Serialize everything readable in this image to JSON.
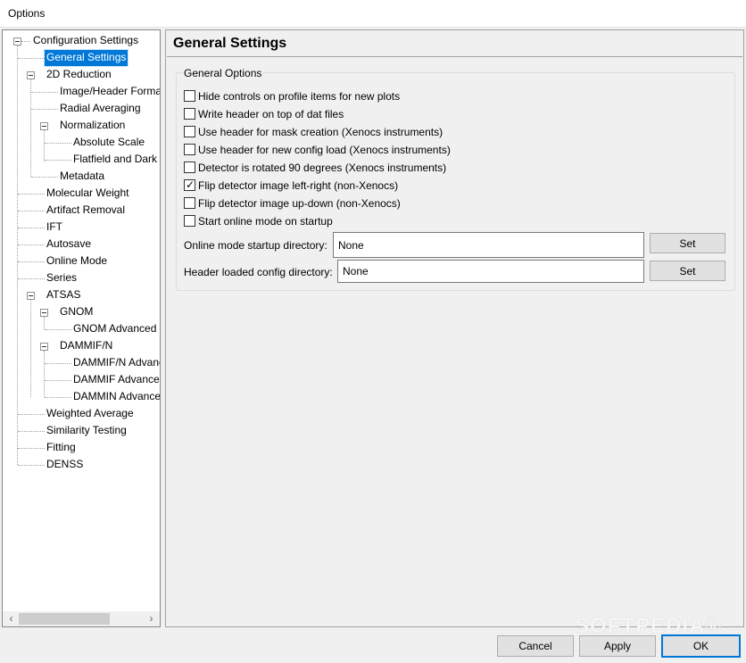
{
  "window": {
    "title": "Options"
  },
  "tree": {
    "items": [
      {
        "label": "Configuration Settings"
      },
      {
        "label": "General Settings"
      },
      {
        "label": "2D Reduction"
      },
      {
        "label": "Image/Header Format"
      },
      {
        "label": "Radial Averaging"
      },
      {
        "label": "Normalization"
      },
      {
        "label": "Absolute Scale"
      },
      {
        "label": "Flatfield and Dark"
      },
      {
        "label": "Metadata"
      },
      {
        "label": "Molecular Weight"
      },
      {
        "label": "Artifact Removal"
      },
      {
        "label": "IFT"
      },
      {
        "label": "Autosave"
      },
      {
        "label": "Online Mode"
      },
      {
        "label": "Series"
      },
      {
        "label": "ATSAS"
      },
      {
        "label": "GNOM"
      },
      {
        "label": "GNOM Advanced"
      },
      {
        "label": "DAMMIF/N"
      },
      {
        "label": "DAMMIF/N Advanced"
      },
      {
        "label": "DAMMIF Advanced"
      },
      {
        "label": "DAMMIN Advanced"
      },
      {
        "label": "Weighted Average"
      },
      {
        "label": "Similarity Testing"
      },
      {
        "label": "Fitting"
      },
      {
        "label": "DENSS"
      }
    ],
    "selected": "General Settings"
  },
  "scroll": {
    "left_arrow": "‹",
    "right_arrow": "›"
  },
  "main": {
    "title": "General Settings",
    "group_label": "General Options",
    "options": [
      {
        "label": "Hide controls on profile items for new plots",
        "checked": false
      },
      {
        "label": "Write header on top of dat files",
        "checked": false
      },
      {
        "label": "Use header for mask creation (Xenocs instruments)",
        "checked": false
      },
      {
        "label": "Use header for new config load (Xenocs instruments)",
        "checked": false
      },
      {
        "label": "Detector is rotated 90 degrees (Xenocs instruments)",
        "checked": false
      },
      {
        "label": "Flip detector image left-right (non-Xenocs)",
        "checked": true
      },
      {
        "label": "Flip detector image up-down (non-Xenocs)",
        "checked": false
      },
      {
        "label": "Start online mode on startup",
        "checked": false
      }
    ],
    "online_dir": {
      "label": "Online mode startup directory:",
      "value": "None",
      "button": "Set"
    },
    "header_dir": {
      "label": "Header loaded config directory:",
      "value": "None",
      "button": "Set"
    }
  },
  "footer": {
    "cancel": "Cancel",
    "apply": "Apply",
    "ok": "OK"
  },
  "watermark": "SOFTPEDIA®",
  "icons": {
    "check": "check-icon",
    "expand": "collapse-icon"
  }
}
